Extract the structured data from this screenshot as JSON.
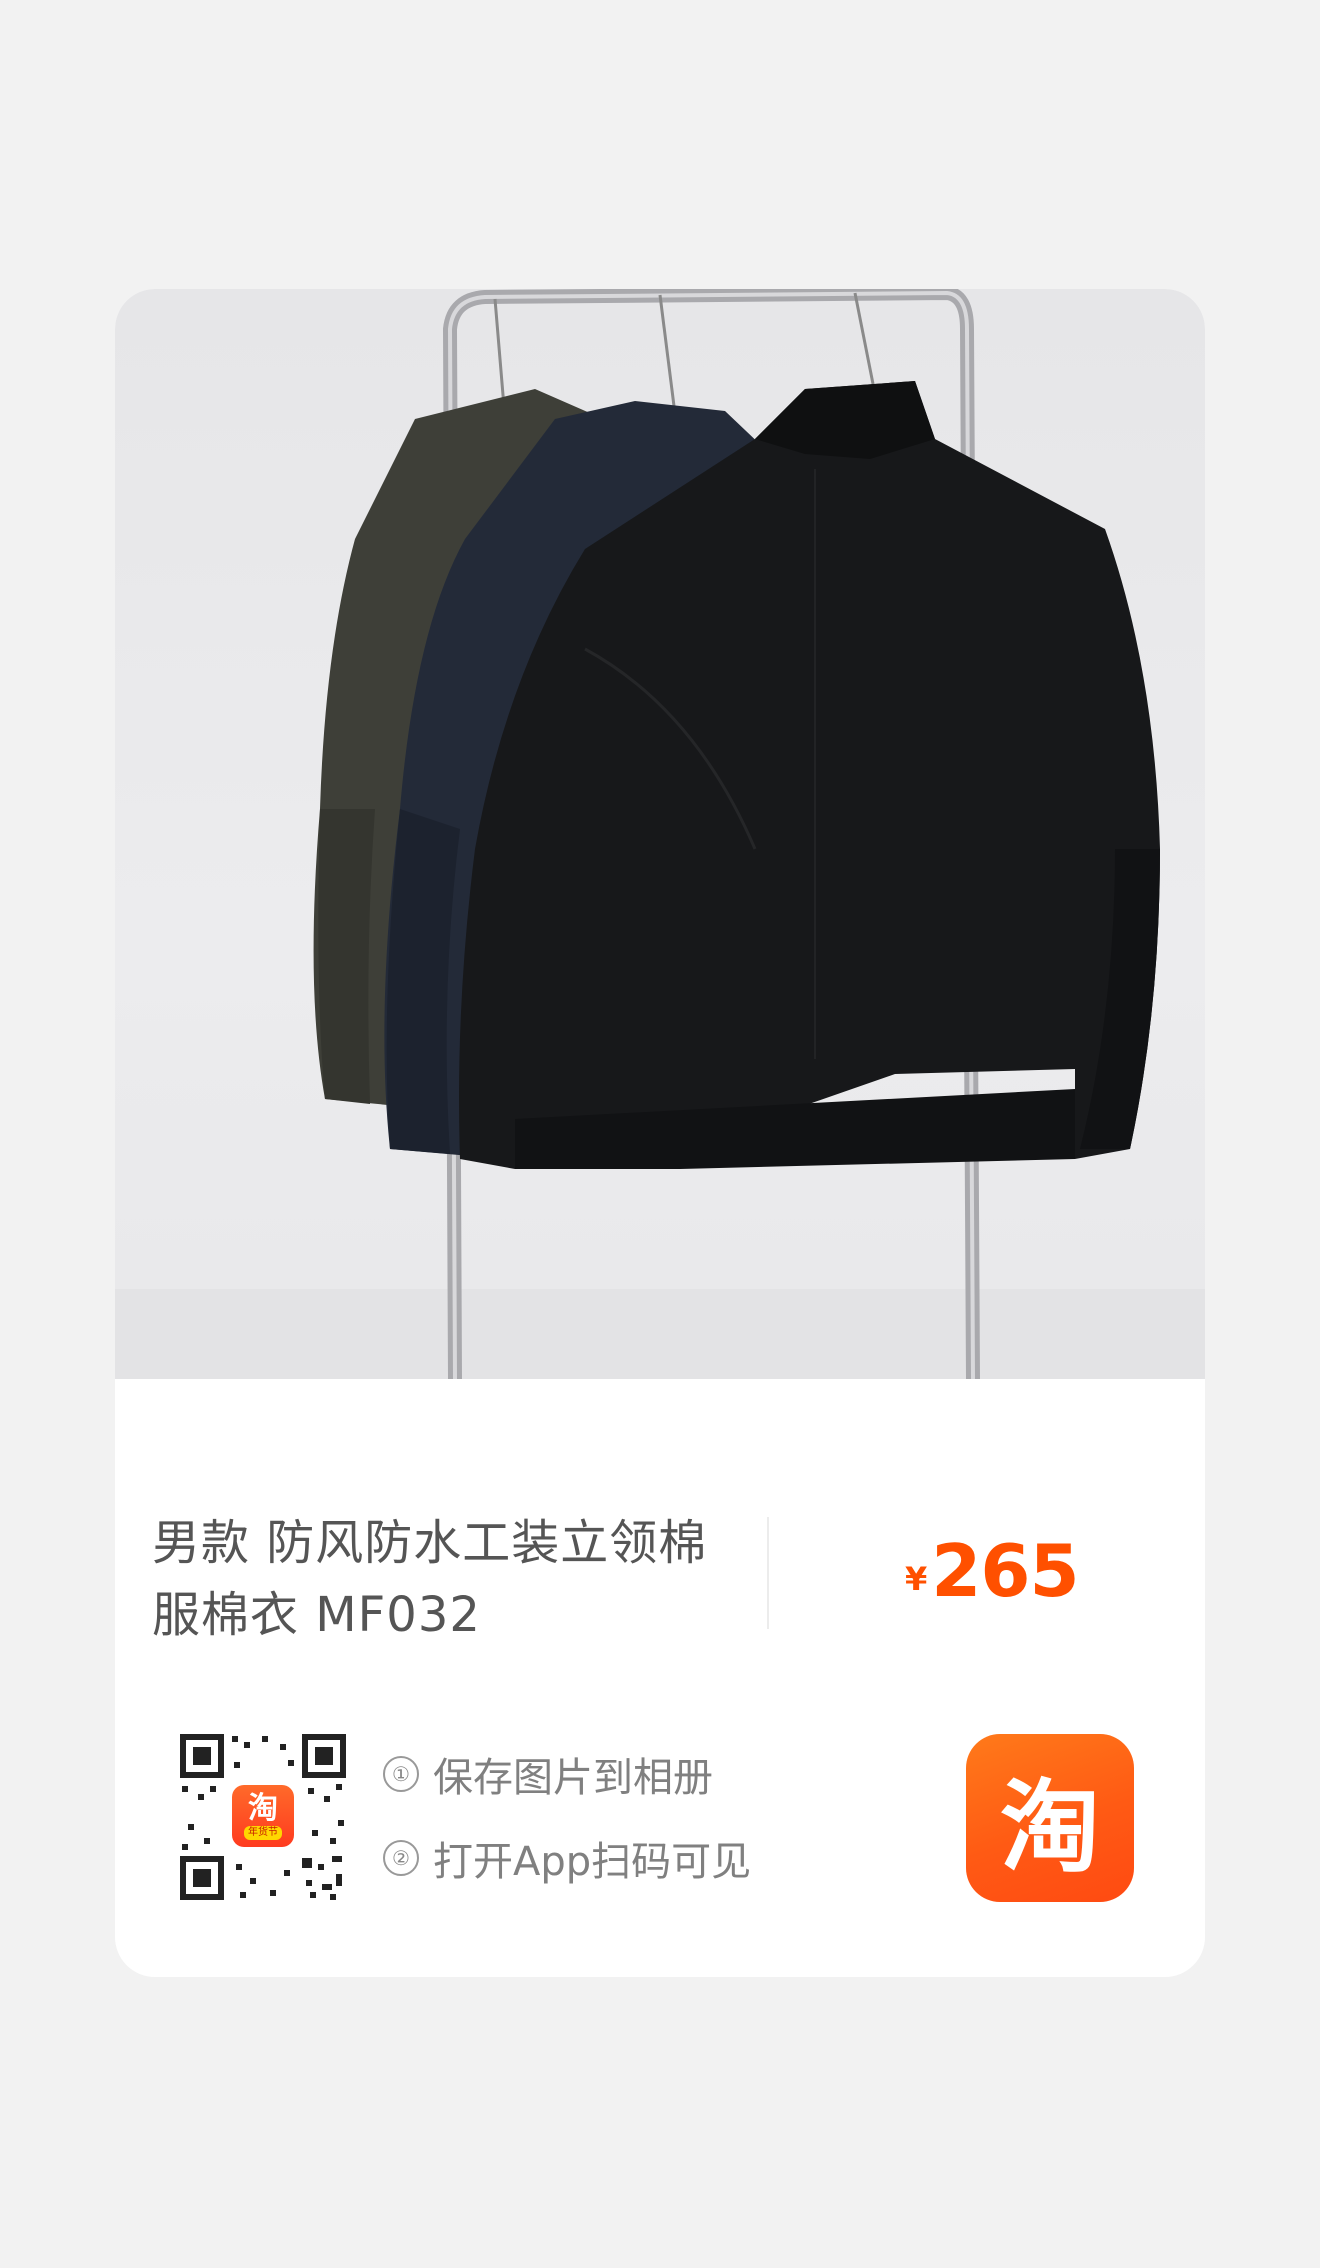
{
  "product": {
    "title": "男款 防风防水工装立领棉服棉衣 MF032",
    "currency_symbol": "¥",
    "price": "265"
  },
  "share": {
    "step1_num": "①",
    "step1": "保存图片到相册",
    "step2_num": "②",
    "step2": "打开App扫码可见",
    "qr_badge_glyph": "淘",
    "qr_badge_sub": "年货节",
    "app_icon_glyph": "淘"
  },
  "colors": {
    "price": "#ff5000",
    "brand_orange": "#ff5a14"
  }
}
